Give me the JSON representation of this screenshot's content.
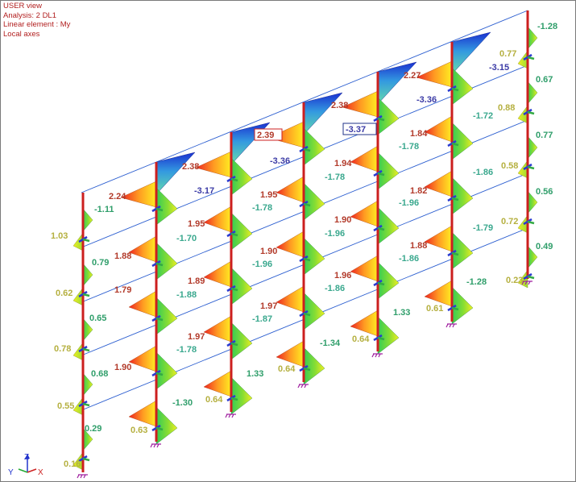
{
  "view_info": {
    "line1": "USER view",
    "line2": "Analysis: 2  DL1",
    "line3": "Linear element : My",
    "line4": "Local axes"
  },
  "axis_triad": {
    "x": "X",
    "y": "Y",
    "z": "Z"
  },
  "colors": {
    "beam_line": "#2d5fd0",
    "column": "#cc1f1f",
    "diagram_negative_gradient": [
      "#33cc55",
      "#88dd33",
      "#eeee22"
    ],
    "diagram_hogging_gradient": [
      "#ffee22",
      "#ff9922",
      "#ee2222"
    ],
    "diagram_top_gradient": [
      "#1a2fd0",
      "#3399e0",
      "#66ddaa"
    ],
    "label_red": "#b23a2a",
    "label_green": "#2f9e6a",
    "label_yellow": "#b5b040",
    "label_blue": "#3b3ba6",
    "label_teal": "#3aa88e",
    "support": "#a020a0"
  },
  "diagram_labels": [
    {
      "id": "c0-r1-bot",
      "text": "0.16",
      "tone": "yellow"
    },
    {
      "id": "c0-r1-top",
      "text": "0.29",
      "tone": "green"
    },
    {
      "id": "c0-r2-bot",
      "text": "0.55",
      "tone": "yellow"
    },
    {
      "id": "c0-r2-top",
      "text": "0.68",
      "tone": "green"
    },
    {
      "id": "c0-r3-bot",
      "text": "0.78",
      "tone": "yellow"
    },
    {
      "id": "c0-r3-top",
      "text": "0.65",
      "tone": "green"
    },
    {
      "id": "c0-r4-bot",
      "text": "0.62",
      "tone": "yellow"
    },
    {
      "id": "c0-r4-top",
      "text": "0.79",
      "tone": "green"
    },
    {
      "id": "c0-r5-bot",
      "text": "1.03",
      "tone": "yellow"
    },
    {
      "id": "c0-r5-top",
      "text": "-1.11",
      "tone": "green"
    },
    {
      "id": "c0-beam5",
      "text": "2.24",
      "tone": "red"
    },
    {
      "id": "c1-r1-bot",
      "text": "0.63",
      "tone": "yellow"
    },
    {
      "id": "c1-r1-top",
      "text": "-1.30",
      "tone": "green"
    },
    {
      "id": "c1-beam1",
      "text": "1.90",
      "tone": "red"
    },
    {
      "id": "c1-r2-top",
      "text": "-1.78",
      "tone": "teal"
    },
    {
      "id": "c1-beam2",
      "text": "1.79",
      "tone": "red"
    },
    {
      "id": "c1-r3-top",
      "text": "-1.88",
      "tone": "teal"
    },
    {
      "id": "c1-beam3",
      "text": "1.88",
      "tone": "red"
    },
    {
      "id": "c1-r4-top",
      "text": "-1.70",
      "tone": "teal"
    },
    {
      "id": "c1-beam5",
      "text": "2.38",
      "tone": "red"
    },
    {
      "id": "c1-top",
      "text": "-3.17",
      "tone": "blue"
    },
    {
      "id": "c2-r1-bot",
      "text": "0.64",
      "tone": "yellow"
    },
    {
      "id": "c2-r1-top",
      "text": "1.33",
      "tone": "green"
    },
    {
      "id": "c2-beam1",
      "text": "1.97",
      "tone": "red"
    },
    {
      "id": "c2-r2-top",
      "text": "-1.87",
      "tone": "teal"
    },
    {
      "id": "c2-beam2",
      "text": "1.89",
      "tone": "red"
    },
    {
      "id": "c2-r3-top",
      "text": "-1.96",
      "tone": "teal"
    },
    {
      "id": "c2-beam3",
      "text": "1.95",
      "tone": "red"
    },
    {
      "id": "c2-r4-top",
      "text": "-1.78",
      "tone": "teal"
    },
    {
      "id": "c2-boxed",
      "text": "2.39",
      "tone": "red"
    },
    {
      "id": "c2-top",
      "text": "-3.36",
      "tone": "blue"
    },
    {
      "id": "c3-r1-bot",
      "text": "0.64",
      "tone": "yellow"
    },
    {
      "id": "c3-r1-top",
      "text": "-1.34",
      "tone": "green"
    },
    {
      "id": "c3-beam1",
      "text": "1.97",
      "tone": "red"
    },
    {
      "id": "c3-r2-top",
      "text": "-1.86",
      "tone": "teal"
    },
    {
      "id": "c3-beam2",
      "text": "1.90",
      "tone": "red"
    },
    {
      "id": "c3-r3-top",
      "text": "-1.96",
      "tone": "teal"
    },
    {
      "id": "c3-beam3",
      "text": "1.95",
      "tone": "red"
    },
    {
      "id": "c3-r4-top",
      "text": "-1.78",
      "tone": "teal"
    },
    {
      "id": "c3-beam5",
      "text": "2.38",
      "tone": "red"
    },
    {
      "id": "c3-boxed",
      "text": "-3.37",
      "tone": "blue"
    },
    {
      "id": "c4-r1-bot",
      "text": "0.64",
      "tone": "yellow"
    },
    {
      "id": "c4-r1-top",
      "text": "1.33",
      "tone": "green"
    },
    {
      "id": "c4-beam1",
      "text": "1.96",
      "tone": "red"
    },
    {
      "id": "c4-r2-top",
      "text": "-1.86",
      "tone": "teal"
    },
    {
      "id": "c4-beam2",
      "text": "1.90",
      "tone": "red"
    },
    {
      "id": "c4-r3-top",
      "text": "-1.96",
      "tone": "teal"
    },
    {
      "id": "c4-beam3",
      "text": "1.94",
      "tone": "red"
    },
    {
      "id": "c4-r4-top",
      "text": "-1.78",
      "tone": "teal"
    },
    {
      "id": "c4-beam5",
      "text": "2.27",
      "tone": "red"
    },
    {
      "id": "c4-top",
      "text": "-3.36",
      "tone": "blue"
    },
    {
      "id": "c5-r1-bot",
      "text": "0.61",
      "tone": "yellow"
    },
    {
      "id": "c5-r1-top",
      "text": "-1.28",
      "tone": "green"
    },
    {
      "id": "c5-beam1",
      "text": "1.88",
      "tone": "red"
    },
    {
      "id": "c5-r2-top",
      "text": "-1.79",
      "tone": "teal"
    },
    {
      "id": "c5-beam2",
      "text": "1.82",
      "tone": "red"
    },
    {
      "id": "c5-r3-top",
      "text": "-1.86",
      "tone": "teal"
    },
    {
      "id": "c5-beam3",
      "text": "1.84",
      "tone": "red"
    },
    {
      "id": "c5-r4-top",
      "text": "-1.72",
      "tone": "teal"
    },
    {
      "id": "c5-top",
      "text": "-3.15",
      "tone": "blue"
    },
    {
      "id": "c6-r1-bot",
      "text": "0.23",
      "tone": "yellow"
    },
    {
      "id": "c6-r1-top",
      "text": "0.49",
      "tone": "green"
    },
    {
      "id": "c6-r2-bot",
      "text": "0.72",
      "tone": "yellow"
    },
    {
      "id": "c6-r2-top",
      "text": "0.56",
      "tone": "green"
    },
    {
      "id": "c6-r3-bot",
      "text": "0.58",
      "tone": "yellow"
    },
    {
      "id": "c6-r3-top",
      "text": "0.77",
      "tone": "green"
    },
    {
      "id": "c6-r4-bot",
      "text": "0.88",
      "tone": "yellow"
    },
    {
      "id": "c6-r4-top",
      "text": "0.67",
      "tone": "green"
    },
    {
      "id": "c6-r5-bot",
      "text": "0.77",
      "tone": "yellow"
    },
    {
      "id": "c6-r5-top",
      "text": "-1.28",
      "tone": "green"
    }
  ]
}
